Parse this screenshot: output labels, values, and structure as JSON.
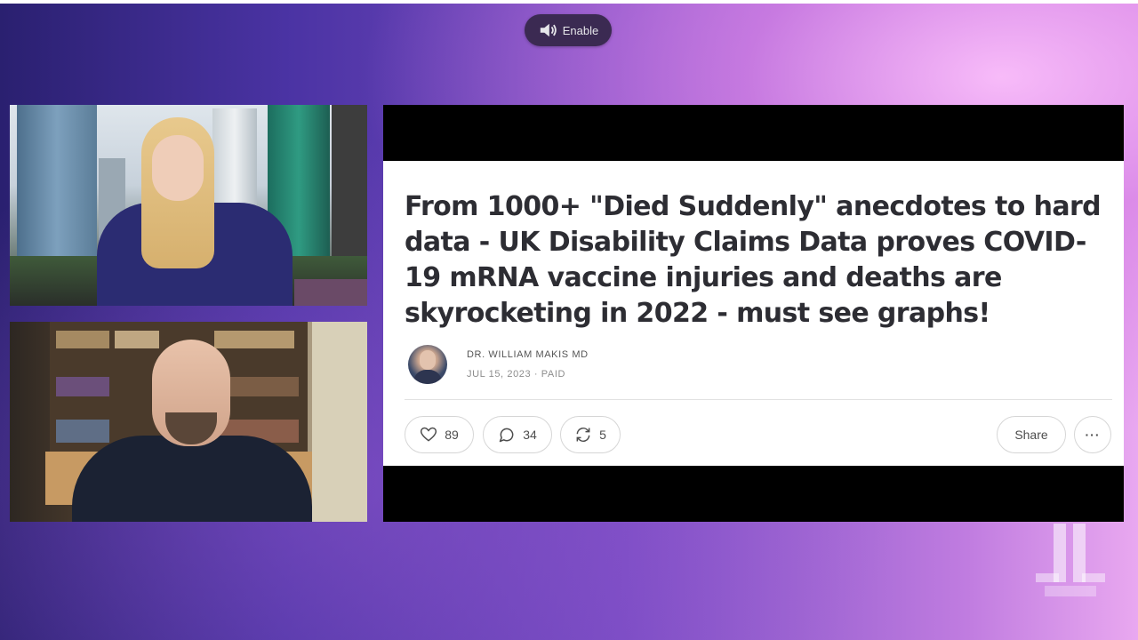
{
  "player": {
    "enable_label": "Enable"
  },
  "article": {
    "headline": "From 1000+ \"Died Suddenly\" anecdotes to hard data - UK Disability Claims Data proves COVID-19 mRNA vaccine injuries and deaths are skyrocketing in 2022 - must see graphs!",
    "author": "DR. WILLIAM MAKIS MD",
    "meta": "JUL 15, 2023 · PAID",
    "likes": "89",
    "comments": "34",
    "restacks": "5",
    "share_label": "Share",
    "more_label": "···"
  },
  "icons": {
    "speaker": "speaker-icon",
    "like": "heart-icon",
    "comment": "comment-bubble-icon",
    "restack": "restack-icon",
    "more": "more-horizontal-icon"
  },
  "colors": {
    "headline": "#2d2d33",
    "pill_border": "#d6d6d6",
    "enable_pill": "#3b2a52"
  }
}
